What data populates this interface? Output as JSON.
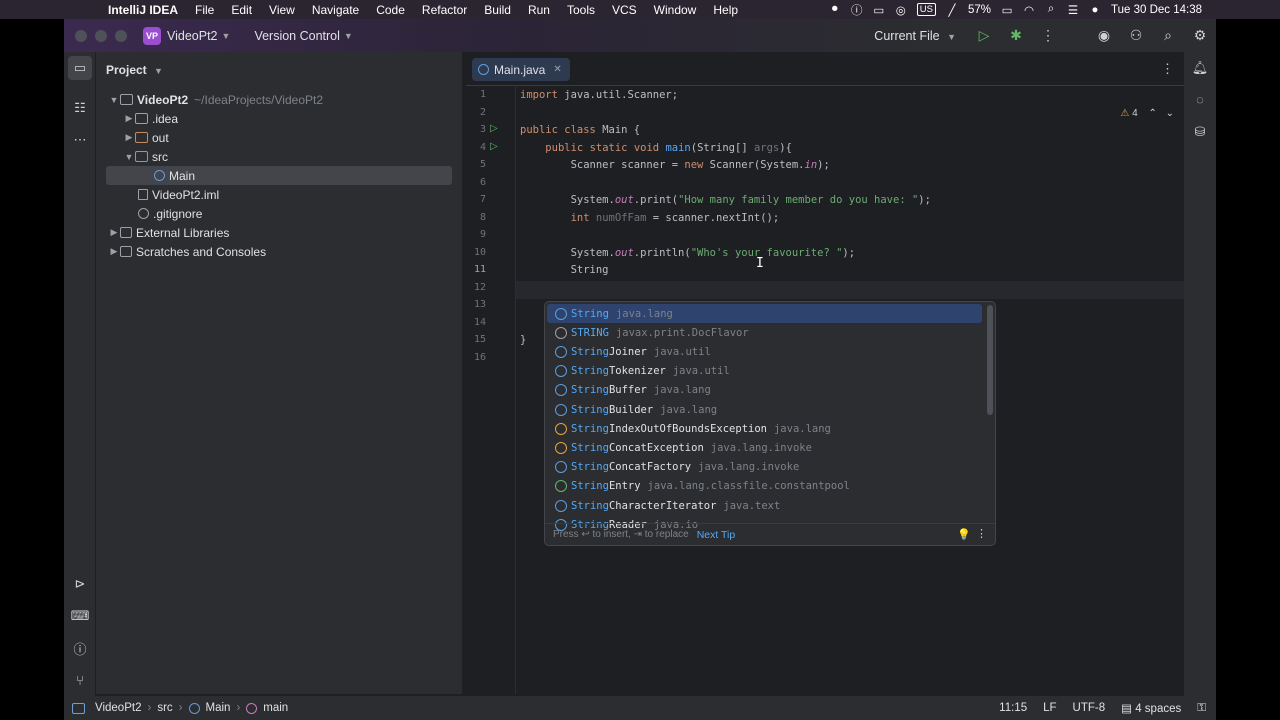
{
  "menubar": {
    "app": "IntelliJ IDEA",
    "items": [
      "File",
      "Edit",
      "View",
      "Navigate",
      "Code",
      "Refactor",
      "Build",
      "Run",
      "Tools",
      "VCS",
      "Window",
      "Help"
    ],
    "battery": "57%",
    "input_source": "US",
    "datetime": "Tue 30 Dec  14:38"
  },
  "titlebar": {
    "project_badge": "VP",
    "project_name": "VideoPt2",
    "vcs": "Version Control",
    "run_config": "Current File"
  },
  "project_panel": {
    "title": "Project",
    "tree": [
      {
        "label": "VideoPt2",
        "path": "~/IdeaProjects/VideoPt2",
        "bold": true
      },
      {
        "label": ".idea"
      },
      {
        "label": "out"
      },
      {
        "label": "src"
      },
      {
        "label": "Main"
      },
      {
        "label": "VideoPt2.iml"
      },
      {
        "label": ".gitignore"
      },
      {
        "label": "External Libraries"
      },
      {
        "label": "Scratches and Consoles"
      }
    ]
  },
  "editor": {
    "tab": "Main.java",
    "inspection_count": "4",
    "line_numbers": [
      "1",
      "2",
      "3",
      "4",
      "5",
      "6",
      "7",
      "8",
      "9",
      "10",
      "11",
      "12",
      "13",
      "14",
      "15",
      "16"
    ],
    "lines": [
      "import java.util.Scanner;",
      "",
      "public class Main {",
      "    public static void main(String[] args){",
      "        Scanner scanner = new Scanner(System.in);",
      "",
      "        System.out.print(\"How many family member do you have: \");",
      "        int numOfFam = scanner.nextInt();",
      "",
      "        System.out.println(\"Who's your favourite? \");",
      "        String",
      "",
      "",
      "",
      "}",
      ""
    ]
  },
  "completion": {
    "items": [
      {
        "match": "String",
        "rest": "",
        "pkg": "java.lang",
        "icon": "class-icon"
      },
      {
        "match": "STRING",
        "rest": "",
        "pkg": "javax.print.DocFlavor",
        "icon": "field-icon"
      },
      {
        "match": "String",
        "rest": "Joiner",
        "pkg": "java.util",
        "icon": "class-icon"
      },
      {
        "match": "String",
        "rest": "Tokenizer",
        "pkg": "java.util",
        "icon": "class-icon"
      },
      {
        "match": "String",
        "rest": "Buffer",
        "pkg": "java.lang",
        "icon": "class-icon"
      },
      {
        "match": "String",
        "rest": "Builder",
        "pkg": "java.lang",
        "icon": "class-icon"
      },
      {
        "match": "String",
        "rest": "IndexOutOfBoundsException",
        "pkg": "java.lang",
        "icon": "exception-icon"
      },
      {
        "match": "String",
        "rest": "ConcatException",
        "pkg": "java.lang.invoke",
        "icon": "exception-icon"
      },
      {
        "match": "String",
        "rest": "ConcatFactory",
        "pkg": "java.lang.invoke",
        "icon": "class-icon"
      },
      {
        "match": "String",
        "rest": "Entry",
        "pkg": "java.lang.classfile.constantpool",
        "icon": "interface-icon"
      },
      {
        "match": "String",
        "rest": "CharacterIterator",
        "pkg": "java.text",
        "icon": "class-icon"
      },
      {
        "match": "String",
        "rest": "Reader",
        "pkg": "java.io",
        "icon": "class-icon"
      }
    ],
    "footer_hint": "Press ↩ to insert, ⇥ to replace",
    "next_tip": "Next Tip"
  },
  "statusbar": {
    "crumbs": [
      "VideoPt2",
      "src",
      "Main",
      "main"
    ],
    "position": "11:15",
    "line_sep": "LF",
    "encoding": "UTF-8",
    "indent": "4 spaces"
  }
}
